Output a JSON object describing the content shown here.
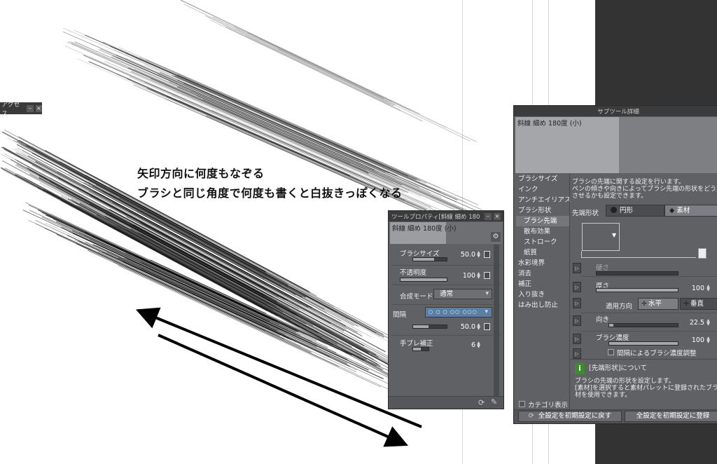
{
  "canvas": {
    "caption_line1": "矢印方向に何度もなぞる",
    "caption_line2": "ブラシと同じ角度で何度も書くと白抜きっぽくなる"
  },
  "mini_panel": {
    "title": "アクセス",
    "minimize": "–",
    "close": "×"
  },
  "tool_property": {
    "title": "ツールプロパティ[斜線 細め 180",
    "preview_label": "斜線 細め 180度 (小)",
    "minimize": "–",
    "close": "×",
    "brush_size": {
      "label": "ブラシサイズ",
      "value": "50.0",
      "fill": 0.62
    },
    "opacity": {
      "label": "不透明度",
      "value": "100",
      "fill": 1.0
    },
    "blend_mode": {
      "label": "合成モード",
      "value": "通常"
    },
    "spacing": {
      "label": "間隔",
      "dots": "○ ○ ○ ○○ ○○○",
      "value": "50.0",
      "fill": 0.45
    },
    "stabilization": {
      "label": "手ブレ補正",
      "value": "6",
      "fill": 0.5
    }
  },
  "sub_tool_detail": {
    "title": "サブツール詳細",
    "preview_label": "斜線 細め 180度 (小)",
    "description_line1": "ブラシの先端に関する設定を行います。",
    "description_line2": "ペンの傾きや向きによってブラシ先端の形状をどう変化",
    "description_line3": "させるかも設定できます。",
    "categories": [
      {
        "label": "ブラシサイズ",
        "sub": false,
        "active": false
      },
      {
        "label": "インク",
        "sub": false,
        "active": false
      },
      {
        "label": "アンチエイリアス",
        "sub": false,
        "active": false
      },
      {
        "label": "ブラシ形状",
        "sub": false,
        "active": false
      },
      {
        "label": "ブラシ先端",
        "sub": true,
        "active": true
      },
      {
        "label": "散布効果",
        "sub": true,
        "active": false
      },
      {
        "label": "ストローク",
        "sub": true,
        "active": false
      },
      {
        "label": "紙質",
        "sub": true,
        "active": false
      },
      {
        "label": "水彩境界",
        "sub": false,
        "active": false
      },
      {
        "label": "消去",
        "sub": false,
        "active": false
      },
      {
        "label": "補正",
        "sub": false,
        "active": false
      },
      {
        "label": "入り抜き",
        "sub": false,
        "active": false
      },
      {
        "label": "はみ出し防止",
        "sub": false,
        "active": false
      }
    ],
    "tip_shape_label": "先端形状",
    "tip_circle": "円形",
    "tip_material": "素材",
    "hardness_label": "硬さ",
    "thickness": {
      "label": "厚さ",
      "value": "100",
      "fill": 1.0
    },
    "apply_direction_label": "適用方向",
    "horizontal": "水平",
    "vertical": "垂直",
    "direction": {
      "label": "向き",
      "value": "22.5",
      "fill": 0.06
    },
    "brush_density": {
      "label": "ブラシ濃度",
      "value": "100",
      "fill": 1.0
    },
    "spacing_density_label": "間隔によるブラシ濃度調整",
    "info_title": "[先端形状]について",
    "info_line1": "ブラシの先端の形状を設定します。",
    "info_line2": "[素材]を選択すると素材パレットに登録されたブラシ",
    "info_line3": "材を使用できます。",
    "category_display": "カテゴリ表示",
    "reset_all": "全設定を初期設定に戻す",
    "register_all": "全設定を初期設定に登録"
  },
  "colors": {
    "panel_bg": "#5f6164",
    "titlebar_bg": "#3a3b3d",
    "dark_area": "#333333",
    "info_green": "#3e8a2f"
  }
}
